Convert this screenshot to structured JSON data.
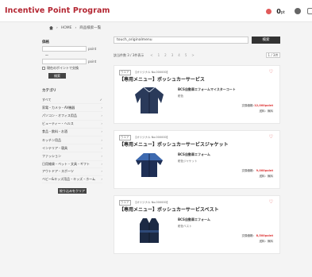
{
  "header": {
    "brand": "Incentive Point Program",
    "points": "0",
    "points_unit": "pt"
  },
  "breadcrumb": [
    "HOME",
    "商品検索一覧"
  ],
  "sidebar": {
    "points_title": "価格",
    "unit": "point",
    "tilde": "〜",
    "owned_only_label": "現在のポイントで交換",
    "search_button": "検索",
    "category_title": "カテゴリ",
    "categories": [
      "すべて",
      "家電・カメラ・AV機器",
      "パソコン・オフィス用品",
      "ビューティー・ヘルス",
      "食品・飲料・お酒",
      "キッチン用品",
      "インテリア・寝具",
      "ファッション",
      "日用雑貨・ペット・文具・ギフト",
      "アウトドア・スポーツ",
      "ベビー&キッズ用品・キッズ・ホーム"
    ],
    "more_button": "絞り込みをクリア"
  },
  "search": {
    "value": "touch_originalmenu",
    "button": "検索"
  },
  "results": {
    "summary": "該当件数 3 / 3件表示",
    "pages": [
      "<",
      "1",
      "2",
      "3",
      "4",
      "5",
      ">"
    ],
    "sort": "1 / 3件"
  },
  "products": [
    {
      "tag": "ウエア",
      "code": "【オリジナル No.000000】",
      "title": "【専用メニュー】ボッシュカーサービス",
      "sub1": "BCS自動車エフォームマイスターコート",
      "sub2": "紺色",
      "price_label": "交換価格：",
      "price": "12,000point",
      "shipping": "送料：無料",
      "kind": "coat"
    },
    {
      "tag": "ウエア",
      "code": "【オリジナル No.000000】",
      "title": "【専用メニュー】ボッシュカーサービスジャケット",
      "sub1": "BCS自動車エフォーム",
      "sub2": "紺色ジャケット",
      "price_label": "交換価格：",
      "price": "9,000point",
      "shipping": "送料：無料",
      "kind": "jacket"
    },
    {
      "tag": "ウエア",
      "code": "【オリジナル No.000000】",
      "title": "【専用メニュー】ボッシュカーサービスベスト",
      "sub1": "BCS自動車エフォーム",
      "sub2": "紺色ベスト",
      "price_label": "交換価格：",
      "price": "8,500point",
      "shipping": "送料：無料",
      "kind": "vest"
    }
  ],
  "colors": {
    "brand": "#b32430",
    "price": "#dd3333"
  }
}
